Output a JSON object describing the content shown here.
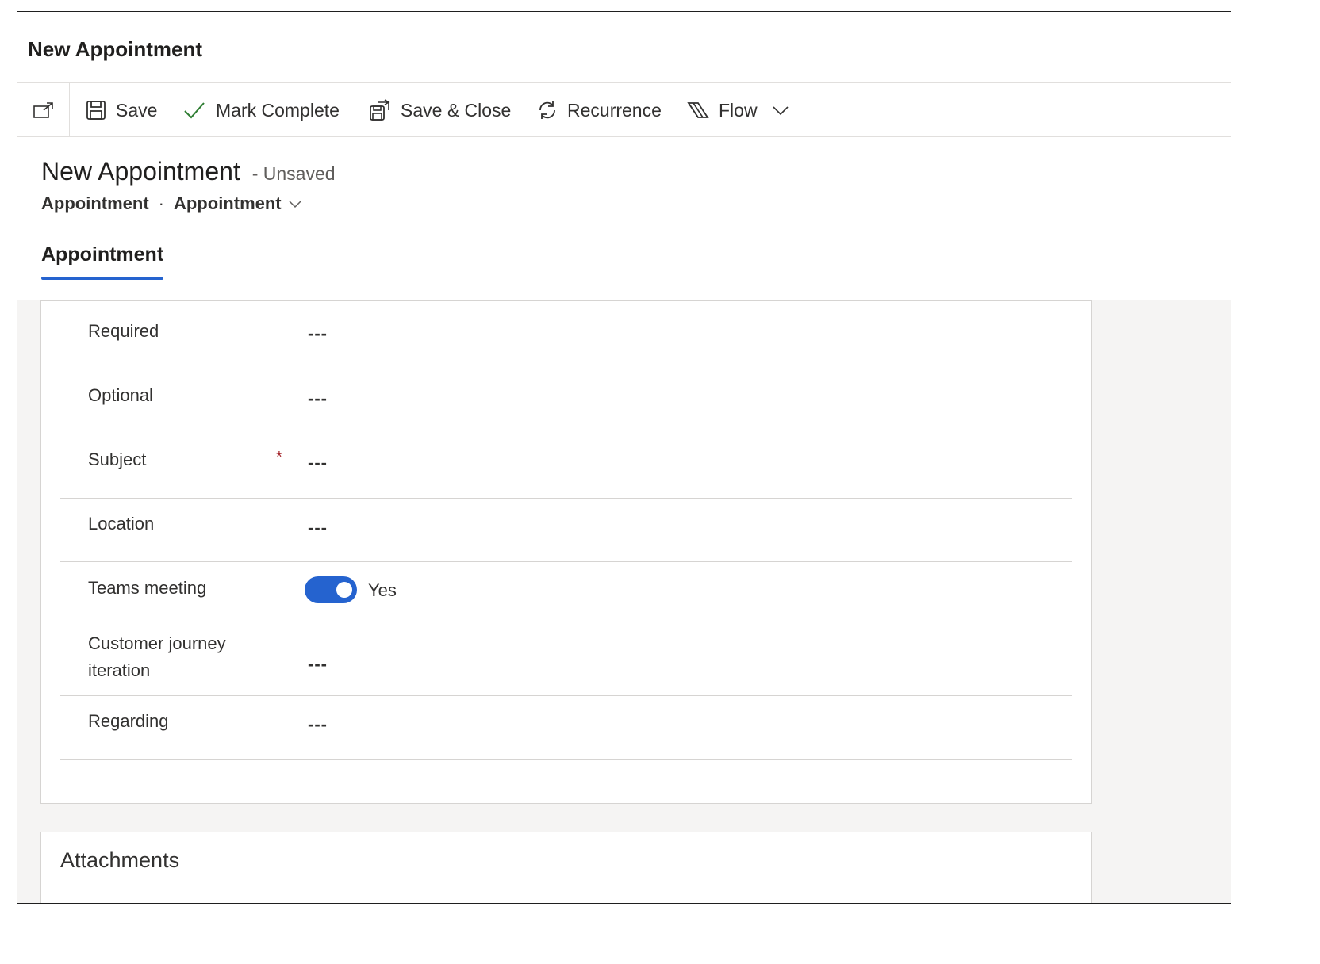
{
  "dialog": {
    "title": "New Appointment"
  },
  "toolbar": {
    "save_label": "Save",
    "mark_complete_label": "Mark Complete",
    "save_close_label": "Save & Close",
    "recurrence_label": "Recurrence",
    "flow_label": "Flow"
  },
  "record": {
    "title": "New Appointment",
    "status": "- Unsaved",
    "entity": "Appointment",
    "separator": "·",
    "form_name": "Appointment"
  },
  "tabs": [
    {
      "label": "Appointment",
      "selected": true
    }
  ],
  "fields": [
    {
      "label": "Required",
      "value": "---",
      "required": false
    },
    {
      "label": "Optional",
      "value": "---",
      "required": false
    },
    {
      "label": "Subject",
      "value": "---",
      "required": true,
      "required_mark": "*"
    },
    {
      "label": "Location",
      "value": "---",
      "required": false
    },
    {
      "label": "Teams meeting",
      "value": "Yes",
      "toggle_on": true
    },
    {
      "label_line1": "Customer journey",
      "label_line2": "iteration",
      "value": "---",
      "required": false
    },
    {
      "label": "Regarding",
      "value": "---",
      "required": false
    }
  ],
  "attachments": {
    "heading": "Attachments"
  },
  "colors": {
    "accent": "#2563cf",
    "required": "#a4262c",
    "body_bg": "#f5f4f3"
  }
}
